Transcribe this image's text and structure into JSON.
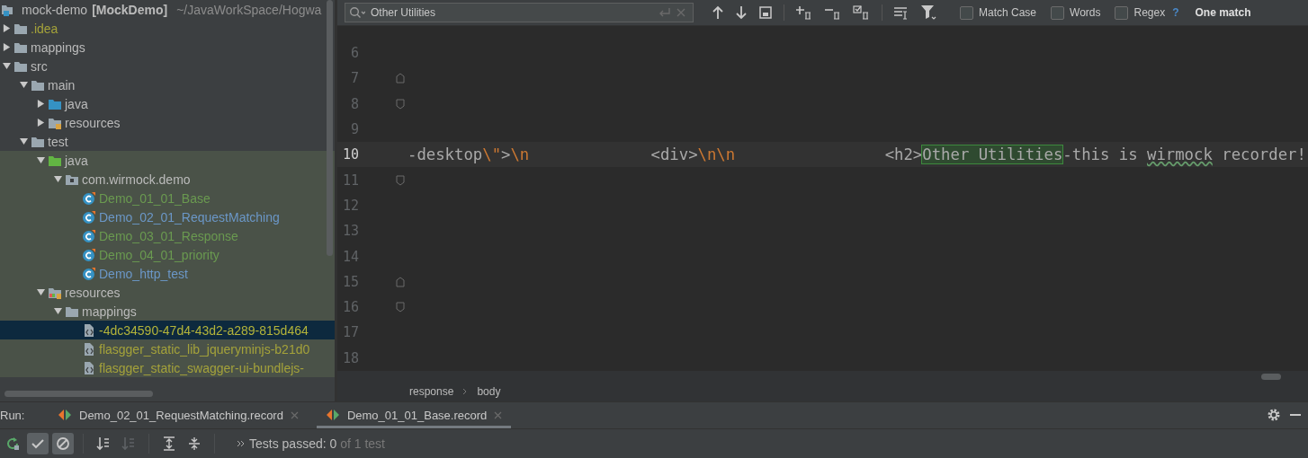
{
  "project_tree": {
    "root": {
      "name": "mock-demo",
      "module": "[MockDemo]",
      "path": "~/JavaWorkSpace/Hogwa"
    },
    "items": [
      {
        "name": ".idea",
        "kind": "folder",
        "expanded": false,
        "selected": false,
        "color": "#a4a23a"
      },
      {
        "name": "mappings",
        "kind": "folder",
        "expanded": false,
        "selected": false,
        "color": "#bbbbbb"
      },
      {
        "name": "src",
        "kind": "folder",
        "expanded": true,
        "selected": false,
        "color": "#bbbbbb",
        "children": [
          {
            "name": "main",
            "kind": "folder",
            "expanded": true,
            "selected": false,
            "color": "#bbbbbb",
            "children": [
              {
                "name": "java",
                "kind": "source-folder",
                "expanded": false,
                "selected": false,
                "color": "#bbbbbb"
              },
              {
                "name": "resources",
                "kind": "resources-folder",
                "expanded": false,
                "selected": false,
                "color": "#bbbbbb"
              }
            ]
          },
          {
            "name": "test",
            "kind": "folder",
            "expanded": true,
            "selected": false,
            "color": "#bbbbbb",
            "tinted": true,
            "children": [
              {
                "name": "java",
                "kind": "test-folder",
                "expanded": true,
                "selected": false,
                "color": "#bbbbbb",
                "children": [
                  {
                    "name": "com.wirmock.demo",
                    "kind": "package",
                    "expanded": true,
                    "selected": false,
                    "color": "#bbbbbb",
                    "children": [
                      {
                        "name": "Demo_01_01_Base",
                        "kind": "class",
                        "selected": false,
                        "color": "#6a9a50"
                      },
                      {
                        "name": "Demo_02_01_RequestMatching",
                        "kind": "class",
                        "selected": false,
                        "color": "#6b97c7"
                      },
                      {
                        "name": "Demo_03_01_Response",
                        "kind": "class",
                        "selected": false,
                        "color": "#6a9a50"
                      },
                      {
                        "name": "Demo_04_01_priority",
                        "kind": "class",
                        "selected": false,
                        "color": "#6a9a50"
                      },
                      {
                        "name": "Demo_http_test",
                        "kind": "class",
                        "selected": false,
                        "color": "#6b97c7"
                      }
                    ]
                  }
                ]
              },
              {
                "name": "resources",
                "kind": "test-resources-folder",
                "expanded": true,
                "selected": false,
                "color": "#bbbbbb",
                "children": [
                  {
                    "name": "mappings",
                    "kind": "folder",
                    "expanded": true,
                    "selected": false,
                    "color": "#bbbbbb",
                    "children": [
                      {
                        "name": "-4dc34590-47d4-43d2-a289-815d464",
                        "kind": "json",
                        "selected": true,
                        "color": "#b4b43a"
                      },
                      {
                        "name": "flasgger_static_lib_jqueryminjs-b21d0",
                        "kind": "json",
                        "selected": false,
                        "color": "#a4a23a"
                      },
                      {
                        "name": "flasgger_static_swagger-ui-bundlejs-",
                        "kind": "json",
                        "selected": false,
                        "color": "#a4a23a"
                      }
                    ]
                  }
                ]
              }
            ]
          }
        ]
      }
    ]
  },
  "editor": {
    "search": {
      "value": "Other Utilities",
      "options": [
        {
          "label": "Match Case",
          "checked": false
        },
        {
          "label": "Words",
          "checked": false
        },
        {
          "label": "Regex",
          "checked": false
        }
      ],
      "help": "?",
      "result": "One match"
    },
    "lines": [
      {
        "number": "6",
        "current": false,
        "fold_start": false,
        "fold_end": false
      },
      {
        "number": "7",
        "current": false,
        "fold_start": true,
        "fold_end": false
      },
      {
        "number": "8",
        "current": false,
        "fold_start": false,
        "fold_end": true
      },
      {
        "number": "9",
        "current": false,
        "fold_start": false,
        "fold_end": false
      },
      {
        "number": "10",
        "current": true,
        "fold_start": false,
        "fold_end": false,
        "tokens": [
          {
            "text": "-desktop",
            "kind": "text"
          },
          {
            "text": "\\\"",
            "kind": "escape"
          },
          {
            "text": ">",
            "kind": "text"
          },
          {
            "text": "\\n",
            "kind": "escape"
          },
          {
            "text": "             <div>",
            "kind": "text"
          },
          {
            "text": "\\n\\n",
            "kind": "escape"
          },
          {
            "text": "                <h2>",
            "kind": "text"
          },
          {
            "text": "Other Utilities",
            "kind": "match"
          },
          {
            "text": "-this is ",
            "kind": "text"
          },
          {
            "text": "wirmock",
            "kind": "typo"
          },
          {
            "text": " recorder!",
            "kind": "text"
          }
        ]
      },
      {
        "number": "11",
        "current": false,
        "fold_start": false,
        "fold_end": true
      },
      {
        "number": "12",
        "current": false,
        "fold_start": false,
        "fold_end": false
      },
      {
        "number": "13",
        "current": false,
        "fold_start": false,
        "fold_end": false
      },
      {
        "number": "14",
        "current": false,
        "fold_start": false,
        "fold_end": false
      },
      {
        "number": "15",
        "current": false,
        "fold_start": true,
        "fold_end": false
      },
      {
        "number": "16",
        "current": false,
        "fold_start": false,
        "fold_end": true
      },
      {
        "number": "17",
        "current": false,
        "fold_start": false,
        "fold_end": false
      },
      {
        "number": "18",
        "current": false,
        "fold_start": false,
        "fold_end": false
      }
    ],
    "breadcrumbs": [
      "response",
      "body"
    ]
  },
  "run_panel": {
    "label": "Run:",
    "tabs": [
      {
        "title": "Demo_02_01_RequestMatching.record",
        "selected": false
      },
      {
        "title": "Demo_01_01_Base.record",
        "selected": true
      }
    ],
    "toolbar": [
      {
        "kind": "rerun"
      },
      {
        "kind": "show-passed",
        "selected": true
      },
      {
        "kind": "show-ignored",
        "selected": true
      },
      {
        "kind": "sort-alpha",
        "disabled": false
      },
      {
        "kind": "sort-duration",
        "disabled": true
      },
      {
        "kind": "expand-all"
      },
      {
        "kind": "collapse-all"
      }
    ],
    "status": {
      "passed": "Tests passed: 0",
      "total": "of 1 test"
    }
  }
}
